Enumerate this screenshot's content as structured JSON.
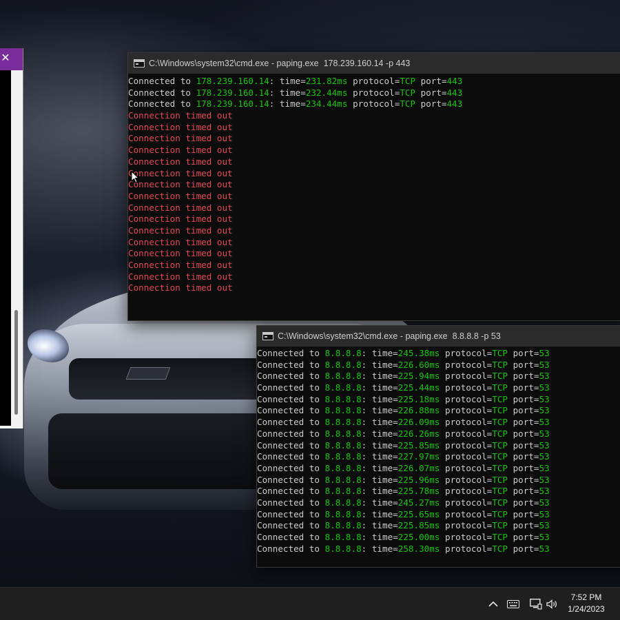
{
  "left_window": {
    "close_glyph": "✕",
    "accent_color": "#7b2c9b"
  },
  "console_1": {
    "title": "C:\\Windows\\system32\\cmd.exe - paping.exe  178.239.160.14 -p 443",
    "lines": [
      {
        "kind": "ok",
        "ip": "178.239.160.14",
        "time": "231.82ms",
        "protocol": "TCP",
        "port": "443"
      },
      {
        "kind": "ok",
        "ip": "178.239.160.14",
        "time": "232.44ms",
        "protocol": "TCP",
        "port": "443"
      },
      {
        "kind": "ok",
        "ip": "178.239.160.14",
        "time": "234.44ms",
        "protocol": "TCP",
        "port": "443"
      },
      {
        "kind": "timeout",
        "text": "Connection timed out"
      },
      {
        "kind": "timeout",
        "text": "Connection timed out"
      },
      {
        "kind": "timeout",
        "text": "Connection timed out"
      },
      {
        "kind": "timeout",
        "text": "Connection timed out"
      },
      {
        "kind": "timeout",
        "text": "Connection timed out"
      },
      {
        "kind": "timeout",
        "text": "Connection timed out"
      },
      {
        "kind": "timeout",
        "text": "Connection timed out"
      },
      {
        "kind": "timeout",
        "text": "Connection timed out"
      },
      {
        "kind": "timeout",
        "text": "Connection timed out"
      },
      {
        "kind": "timeout",
        "text": "Connection timed out"
      },
      {
        "kind": "timeout",
        "text": "Connection timed out"
      },
      {
        "kind": "timeout",
        "text": "Connection timed out"
      },
      {
        "kind": "timeout",
        "text": "Connection timed out"
      },
      {
        "kind": "timeout",
        "text": "Connection timed out"
      },
      {
        "kind": "timeout",
        "text": "Connection timed out"
      },
      {
        "kind": "timeout",
        "text": "Connection timed out"
      }
    ]
  },
  "console_2": {
    "title": "C:\\Windows\\system32\\cmd.exe - paping.exe  8.8.8.8 -p 53",
    "lines": [
      {
        "kind": "ok",
        "ip": "8.8.8.8",
        "time": "245.38ms",
        "protocol": "TCP",
        "port": "53"
      },
      {
        "kind": "ok",
        "ip": "8.8.8.8",
        "time": "226.60ms",
        "protocol": "TCP",
        "port": "53"
      },
      {
        "kind": "ok",
        "ip": "8.8.8.8",
        "time": "225.94ms",
        "protocol": "TCP",
        "port": "53"
      },
      {
        "kind": "ok",
        "ip": "8.8.8.8",
        "time": "225.44ms",
        "protocol": "TCP",
        "port": "53"
      },
      {
        "kind": "ok",
        "ip": "8.8.8.8",
        "time": "225.18ms",
        "protocol": "TCP",
        "port": "53"
      },
      {
        "kind": "ok",
        "ip": "8.8.8.8",
        "time": "226.88ms",
        "protocol": "TCP",
        "port": "53"
      },
      {
        "kind": "ok",
        "ip": "8.8.8.8",
        "time": "226.09ms",
        "protocol": "TCP",
        "port": "53"
      },
      {
        "kind": "ok",
        "ip": "8.8.8.8",
        "time": "226.26ms",
        "protocol": "TCP",
        "port": "53"
      },
      {
        "kind": "ok",
        "ip": "8.8.8.8",
        "time": "225.85ms",
        "protocol": "TCP",
        "port": "53"
      },
      {
        "kind": "ok",
        "ip": "8.8.8.8",
        "time": "227.97ms",
        "protocol": "TCP",
        "port": "53"
      },
      {
        "kind": "ok",
        "ip": "8.8.8.8",
        "time": "226.07ms",
        "protocol": "TCP",
        "port": "53"
      },
      {
        "kind": "ok",
        "ip": "8.8.8.8",
        "time": "225.96ms",
        "protocol": "TCP",
        "port": "53"
      },
      {
        "kind": "ok",
        "ip": "8.8.8.8",
        "time": "225.78ms",
        "protocol": "TCP",
        "port": "53"
      },
      {
        "kind": "ok",
        "ip": "8.8.8.8",
        "time": "245.27ms",
        "protocol": "TCP",
        "port": "53"
      },
      {
        "kind": "ok",
        "ip": "8.8.8.8",
        "time": "225.65ms",
        "protocol": "TCP",
        "port": "53"
      },
      {
        "kind": "ok",
        "ip": "8.8.8.8",
        "time": "225.85ms",
        "protocol": "TCP",
        "port": "53"
      },
      {
        "kind": "ok",
        "ip": "8.8.8.8",
        "time": "225.00ms",
        "protocol": "TCP",
        "port": "53"
      },
      {
        "kind": "ok",
        "ip": "8.8.8.8",
        "time": "258.30ms",
        "protocol": "TCP",
        "port": "53"
      }
    ]
  },
  "console_text": {
    "connected_to": "Connected to ",
    "time_label": ": time=",
    "protocol_label": " protocol=",
    "port_label": " port="
  },
  "colors": {
    "text_gray": "#cccccc",
    "value_green": "#16c60c",
    "error_red": "#e74856"
  },
  "taskbar": {
    "tray_icons": [
      "chevron-up-icon",
      "keyboard-icon",
      "network-icon",
      "volume-icon"
    ],
    "time": "7:52 PM",
    "date": "1/24/2023"
  }
}
